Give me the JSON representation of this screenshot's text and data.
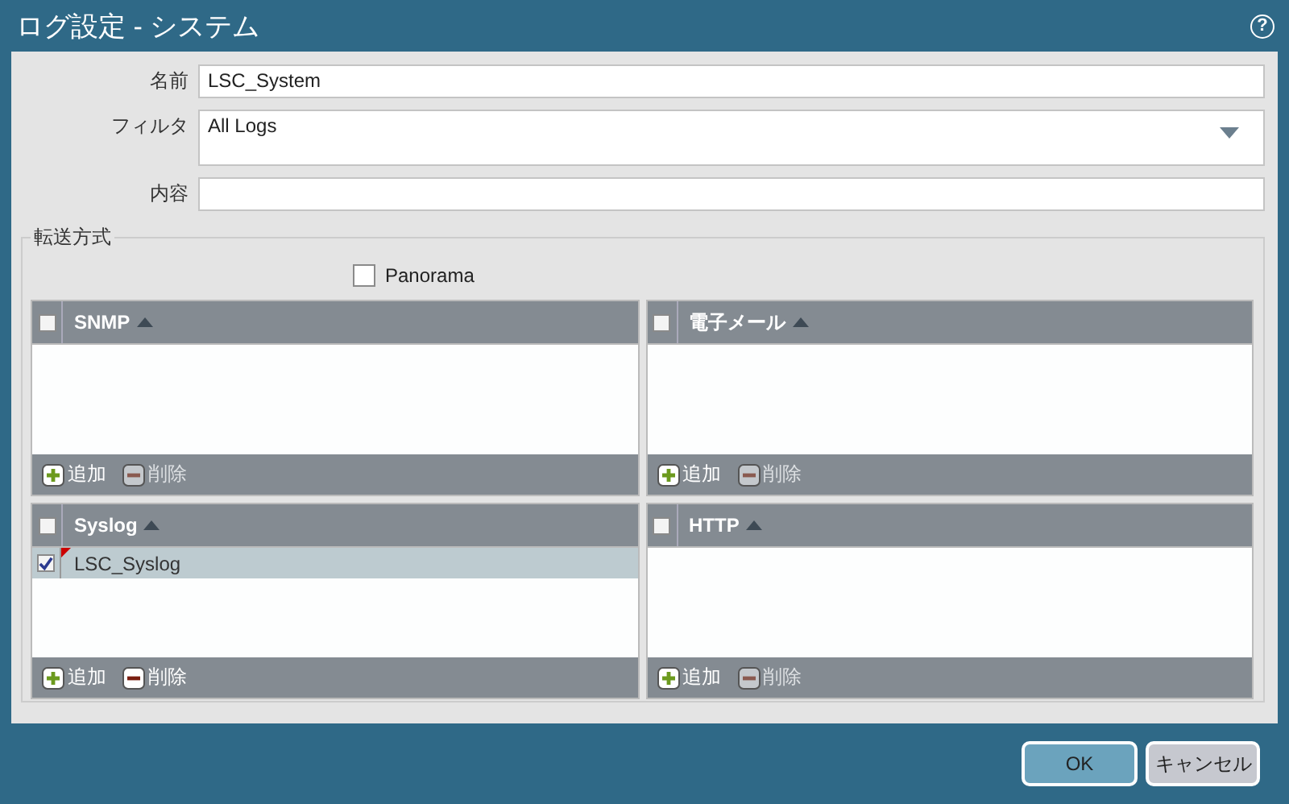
{
  "window": {
    "title": "ログ設定 - システム",
    "help": "?"
  },
  "form": {
    "name_label": "名前",
    "name_value": "LSC_System",
    "filter_label": "フィルタ",
    "filter_value": "All Logs",
    "content_label": "内容"
  },
  "forwarding": {
    "legend": "転送方式",
    "panorama": {
      "label": "Panorama",
      "checked": false
    },
    "panels": [
      {
        "title": "SNMP",
        "header_checked": false,
        "add": "追加",
        "delete": {
          "label": "削除",
          "disabled": true
        }
      },
      {
        "title": "電子メール",
        "header_checked": false,
        "add": "追加",
        "delete": {
          "label": "削除",
          "disabled": true
        }
      },
      {
        "title": "Syslog",
        "header_checked": false,
        "rows": [
          {
            "name": "LSC_Syslog",
            "checked": true,
            "selected": true
          }
        ],
        "add": "追加",
        "delete": {
          "label": "削除",
          "disabled": false
        }
      },
      {
        "title": "HTTP",
        "header_checked": false,
        "add": "追加",
        "delete": {
          "label": "削除",
          "disabled": true
        }
      }
    ]
  },
  "buttons": [
    {
      "label": "OK",
      "kind": "primary"
    },
    {
      "label": "キャンセル",
      "kind": "secondary"
    }
  ]
}
